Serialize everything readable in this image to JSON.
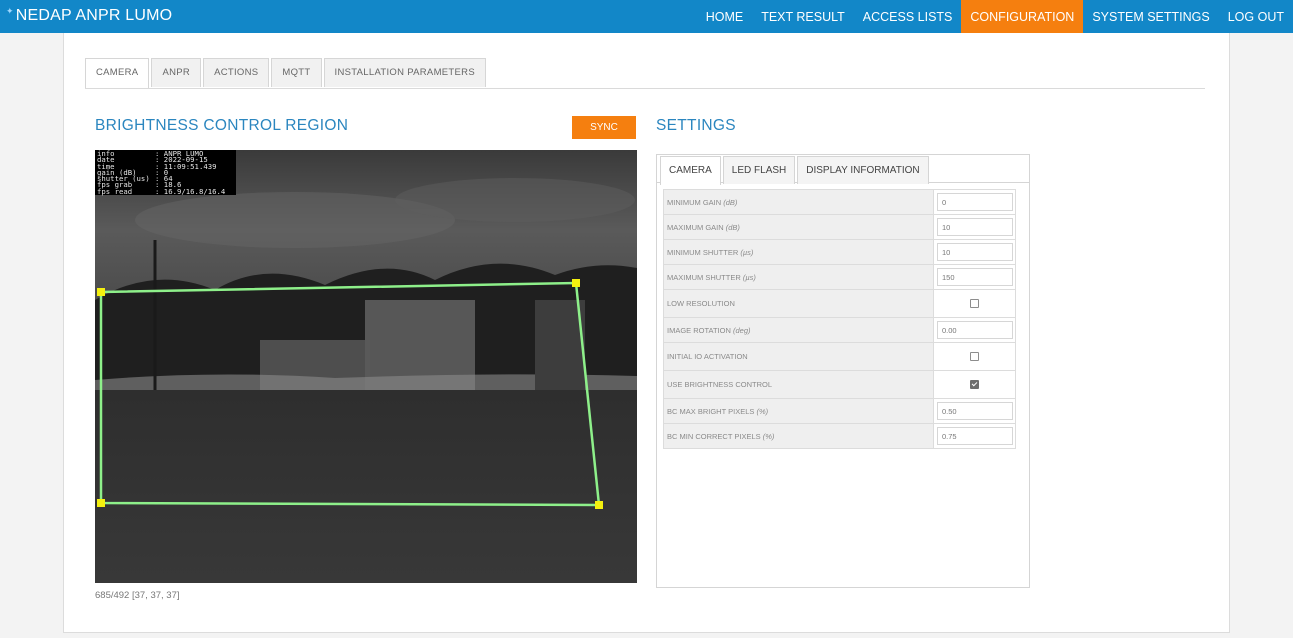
{
  "app": {
    "title": "NEDAP ANPR LUMO"
  },
  "nav": [
    {
      "label": "HOME",
      "active": false
    },
    {
      "label": "TEXT RESULT",
      "active": false
    },
    {
      "label": "ACCESS LISTS",
      "active": false
    },
    {
      "label": "CONFIGURATION",
      "active": true
    },
    {
      "label": "SYSTEM SETTINGS",
      "active": false
    },
    {
      "label": "LOG OUT",
      "active": false
    }
  ],
  "tabs": [
    {
      "label": "CAMERA",
      "active": true
    },
    {
      "label": "ANPR",
      "active": false
    },
    {
      "label": "ACTIONS",
      "active": false
    },
    {
      "label": "MQTT",
      "active": false
    },
    {
      "label": "INSTALLATION PARAMETERS",
      "active": false
    }
  ],
  "brightness": {
    "title": "BRIGHTNESS CONTROL REGION",
    "sync_label": "SYNC",
    "overlay": [
      [
        "info",
        "ANPR LUMO"
      ],
      [
        "date",
        "2022-09-15"
      ],
      [
        "time",
        "11:09:51.439"
      ],
      [
        "gain (dB)",
        "0"
      ],
      [
        "shutter (us)",
        "64"
      ],
      [
        "fps grab",
        "18.6"
      ],
      [
        "fps read",
        "16.9/16.8/16.4"
      ]
    ],
    "coords": "685/492 [37, 37, 37]"
  },
  "settings": {
    "title": "SETTINGS",
    "tabs": [
      {
        "label": "CAMERA",
        "active": true
      },
      {
        "label": "LED FLASH",
        "active": false
      },
      {
        "label": "DISPLAY INFORMATION",
        "active": false
      }
    ],
    "rows": [
      {
        "label": "MINIMUM GAIN",
        "unit": "(dB)",
        "type": "input",
        "value": "0"
      },
      {
        "label": "MAXIMUM GAIN",
        "unit": "(dB)",
        "type": "input",
        "value": "10"
      },
      {
        "label": "MINIMUM SHUTTER",
        "unit": "(µs)",
        "type": "input",
        "value": "10"
      },
      {
        "label": "MAXIMUM SHUTTER",
        "unit": "(µs)",
        "type": "input",
        "value": "150"
      },
      {
        "label": "LOW RESOLUTION",
        "unit": "",
        "type": "checkbox",
        "checked": false
      },
      {
        "label": "IMAGE ROTATION",
        "unit": "(deg)",
        "type": "input",
        "value": "0.00"
      },
      {
        "label": "INITIAL IO ACTIVATION",
        "unit": "",
        "type": "checkbox",
        "checked": false
      },
      {
        "label": "USE BRIGHTNESS CONTROL",
        "unit": "",
        "type": "checkbox",
        "checked": true
      },
      {
        "label": "BC MAX BRIGHT PIXELS",
        "unit": "(%)",
        "type": "input",
        "value": "0.50"
      },
      {
        "label": "BC MIN CORRECT PIXELS",
        "unit": "(%)",
        "type": "input",
        "value": "0.75"
      }
    ]
  },
  "colors": {
    "navbar": "#1287c8",
    "accent": "#f57f0f",
    "title": "#2b86bf",
    "region_line": "#8ef08a",
    "region_handle": "#f4f00f"
  }
}
